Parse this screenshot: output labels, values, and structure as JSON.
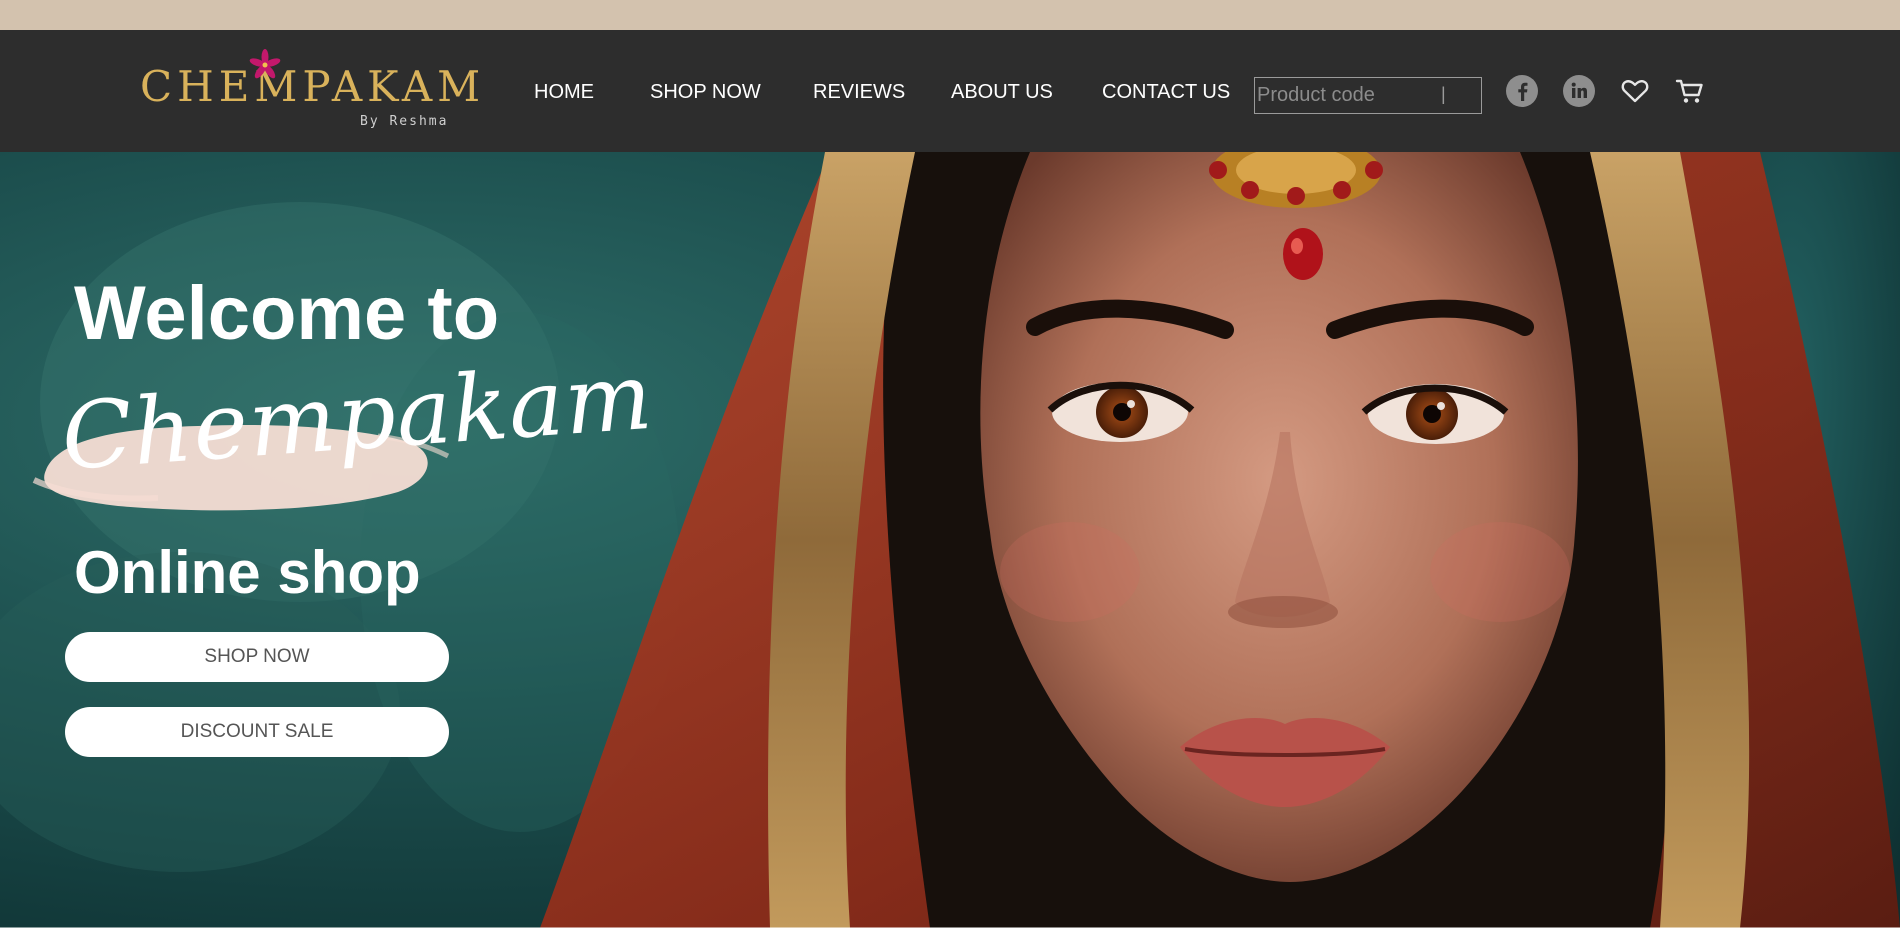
{
  "brand": {
    "logo_text": "CHEMPAKAM",
    "byline": "By Reshma"
  },
  "nav": {
    "items": [
      {
        "label": "HOME"
      },
      {
        "label": "SHOP NOW"
      },
      {
        "label": "REVIEWS"
      },
      {
        "label": "ABOUT US"
      },
      {
        "label": "CONTACT US"
      }
    ]
  },
  "search": {
    "placeholder": "Product code",
    "value": "",
    "caret": "|"
  },
  "social_icons": [
    "facebook-icon",
    "linkedin-icon",
    "heart-icon",
    "cart-icon"
  ],
  "hero": {
    "welcome": "Welcome to",
    "script_name": "Chempakam",
    "subtitle": "Online shop",
    "buttons": [
      {
        "label": "SHOP NOW"
      },
      {
        "label": "DISCOUNT SALE"
      }
    ]
  },
  "colors": {
    "top_strip": "#d3c2ae",
    "navbar": "#2d2d2d",
    "logo_gold": "#d9b25b",
    "hero_teal": "#1f5a58",
    "button_bg": "#ffffff",
    "button_text": "#555555"
  }
}
